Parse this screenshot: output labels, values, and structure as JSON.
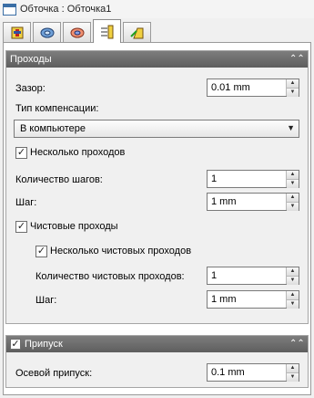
{
  "window": {
    "title": "Обточка : Обточка1"
  },
  "tabs": [
    {
      "icon": "tool-icon"
    },
    {
      "icon": "stock-icon"
    },
    {
      "icon": "model-icon"
    },
    {
      "icon": "passes-icon",
      "active": true
    },
    {
      "icon": "links-icon"
    }
  ],
  "passes_group": {
    "title": "Проходы",
    "gap_label": "Зазор:",
    "gap_value": "0.01 mm",
    "compensation_label": "Тип компенсации:",
    "compensation_value": "В компьютере",
    "multiple_passes_label": "Несколько проходов",
    "steps_count_label": "Количество шагов:",
    "steps_count_value": "1",
    "step_label": "Шаг:",
    "step_value": "1 mm",
    "finishing_passes_label": "Чистовые проходы",
    "multiple_finishing_label": "Несколько чистовых проходов",
    "finishing_count_label": "Количество чистовых проходов:",
    "finishing_count_value": "1",
    "finishing_step_label": "Шаг:",
    "finishing_step_value": "1 mm"
  },
  "allowance_group": {
    "title": "Припуск",
    "axial_label": "Осевой припуск:",
    "axial_value": "0.1 mm"
  },
  "colors": {
    "header": "#6e6e6e",
    "accent": "#3a6ea5"
  }
}
